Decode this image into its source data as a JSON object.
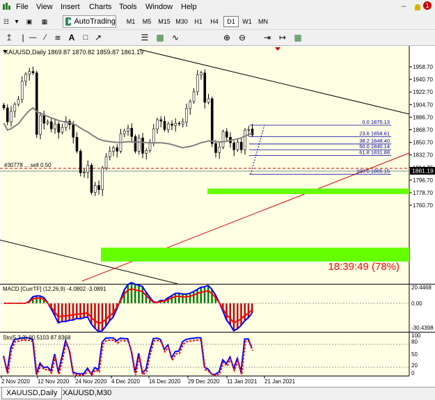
{
  "menu": {
    "items": [
      "File",
      "View",
      "Insert",
      "Charts",
      "Tools",
      "Window",
      "Help"
    ],
    "notification_count": "1"
  },
  "toolbar": {
    "autotrading_label": "AutoTrading",
    "timeframes": [
      "M1",
      "M5",
      "M15",
      "M30",
      "H1",
      "H4",
      "D1",
      "W1",
      "MN"
    ],
    "active_timeframe": "D1"
  },
  "chart": {
    "header": "XAUUSD,Daily  1869.87 1870.82 1859.87 1861.19",
    "current_price": "1861.19",
    "order_label": "#30778 ... sell 0.50",
    "timer_text": "18:39:49 (78%)",
    "colors": {
      "background": "#ffffe4",
      "bull": "#0000ff",
      "bear": "#cc0000",
      "zone": "#66ff00",
      "trendline_red": "#dd0000",
      "ma": "#808080"
    },
    "price_axis": [
      "1958.70",
      "1940.70",
      "1922.70",
      "1904.70",
      "1886.70",
      "1868.70",
      "1850.70",
      "1832.70",
      "1814.70",
      "1796.70",
      "1778.70",
      "1760.70"
    ],
    "fib_levels": [
      {
        "label": "0.0  1875.13"
      },
      {
        "label": "23.6  1858.61"
      },
      {
        "label": "38.2  1848.40"
      },
      {
        "label": "50.0  1840.14"
      },
      {
        "label": "61.8  1831.88"
      },
      {
        "label": "100.0  1805.15"
      }
    ]
  },
  "macd": {
    "label": "MACD [CurrTF] (12,26,9) -4.0802 -3.0891",
    "axis": [
      "20.4468",
      "0.00",
      "-30.4398"
    ]
  },
  "stoch": {
    "label": "Sto(5,3,3) 90.5103 87.8368",
    "axis": [
      "100",
      "80",
      "50",
      "20",
      "0"
    ]
  },
  "time_axis": [
    "2 Nov 2020",
    "12 Nov 2020",
    "24 Nov 2020",
    "4 Dec 2020",
    "16 Dec 2020",
    "29 Dec 2020",
    "11 Jan 2021",
    "21 Jan 2021"
  ],
  "tabs": [
    "XAUUSD,Daily",
    "XAUUSD,M30"
  ],
  "chart_data": {
    "type": "candlestick",
    "symbol": "XAUUSD",
    "timeframe": "Daily",
    "last_bar": {
      "open": 1869.87,
      "high": 1870.82,
      "low": 1859.87,
      "close": 1861.19
    },
    "closes": [
      1900,
      1880,
      1895,
      1905,
      1912,
      1938,
      1948,
      1952,
      1950,
      1862,
      1889,
      1878,
      1880,
      1870,
      1877,
      1865,
      1872,
      1881,
      1876,
      1858,
      1838,
      1807,
      1808,
      1818,
      1779,
      1789,
      1783,
      1814,
      1830,
      1838,
      1843,
      1838,
      1863,
      1867,
      1871,
      1859,
      1838,
      1857,
      1835,
      1839,
      1850,
      1870,
      1883,
      1881,
      1869,
      1877,
      1875,
      1878,
      1877,
      1880,
      1899,
      1909,
      1923,
      1947,
      1950,
      1908,
      1913,
      1849,
      1836,
      1844,
      1866,
      1858,
      1850,
      1840,
      1851,
      1840,
      1868,
      1869,
      1861
    ],
    "fib_values": [
      1875.13,
      1858.61,
      1848.4,
      1840.14,
      1831.88,
      1805.15
    ],
    "ylim": [
      1756,
      1974
    ],
    "macd": {
      "main": -4.0802,
      "signal": -3.0891
    },
    "stochastic": {
      "k": 90.5103,
      "d": 87.8368
    }
  }
}
